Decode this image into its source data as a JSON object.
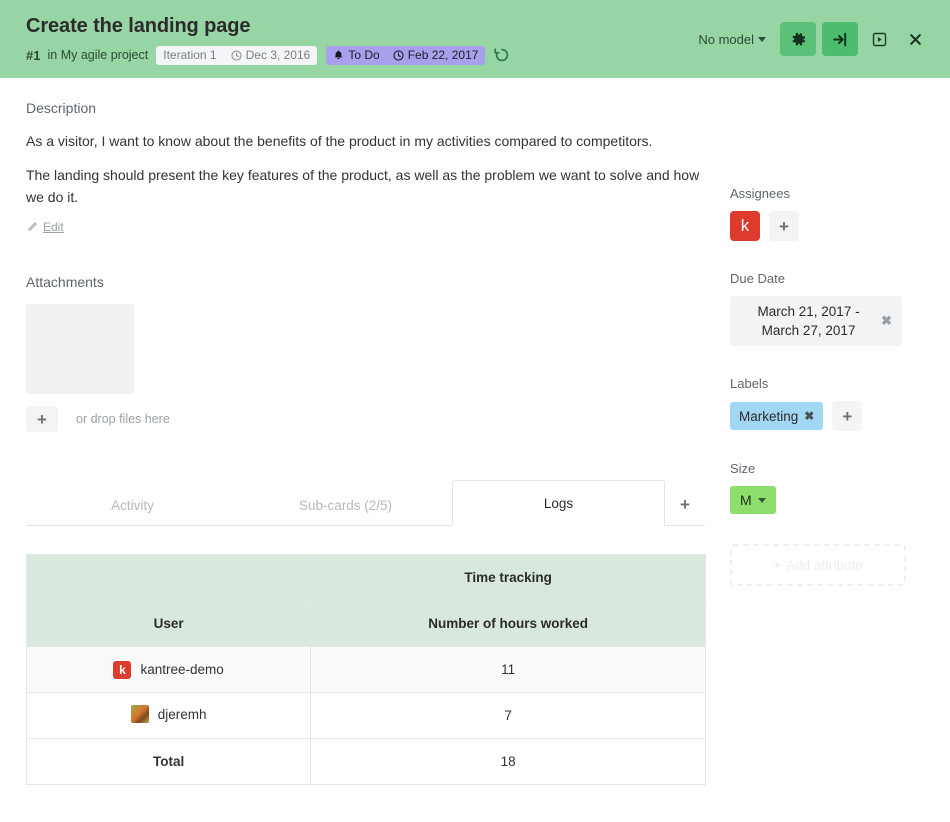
{
  "header": {
    "title": "Create the landing page",
    "card_number": "#1",
    "in_label": "in",
    "project_name": "My agile project",
    "iteration": {
      "name": "Iteration 1",
      "date": "Dec 3, 2016",
      "clock_icon": "clock-icon"
    },
    "status": {
      "label": "To Do",
      "date": "Feb 22, 2017",
      "bell_icon": "bell-icon",
      "clock_icon": "clock-icon",
      "color": "#a8a0ea"
    },
    "history_icon": "history-icon",
    "model_select": "No model",
    "buttons": {
      "gear": "gear-icon",
      "login": "sign-in-icon",
      "play": "play-box-icon",
      "close": "close-icon"
    },
    "background_color": "#97d5a4"
  },
  "description": {
    "heading": "Description",
    "paragraphs": [
      "As a visitor, I want to know about the benefits of the product in my activities compared to competitors.",
      "The landing should present the key features of the product, as well as the problem we want to solve and how we do it."
    ],
    "edit_label": "Edit",
    "edit_icon": "pencil-icon"
  },
  "attachments": {
    "heading": "Attachments",
    "add_label": "+",
    "drop_hint": "or drop files here"
  },
  "tabs": {
    "items": [
      {
        "label": "Activity",
        "active": false
      },
      {
        "label": "Sub-cards (2/5)",
        "active": false
      },
      {
        "label": "Logs",
        "active": true
      }
    ],
    "add_label": "+"
  },
  "log_table": {
    "group_header": "Time tracking",
    "columns": [
      "User",
      "Number of hours worked"
    ],
    "rows": [
      {
        "user": "kantree-demo",
        "avatar": "k",
        "avatar_type": "letter",
        "hours": "11"
      },
      {
        "user": "djeremh",
        "avatar": "",
        "avatar_type": "photo",
        "hours": "7"
      }
    ],
    "total_label": "Total",
    "total_value": "18"
  },
  "sidebar": {
    "assignees": {
      "label": "Assignees",
      "avatar_letter": "k",
      "avatar_color": "#dd3b2e",
      "add_label": "+"
    },
    "due_date": {
      "label": "Due Date",
      "value": "March 21, 2017 - March 27, 2017",
      "remove_label": "✖"
    },
    "labels": {
      "label": "Labels",
      "chips": [
        {
          "name": "Marketing",
          "remove": "✖",
          "color": "#a2d7f3"
        }
      ],
      "add_label": "+"
    },
    "size": {
      "label": "Size",
      "value": "M",
      "color": "#8ede6e"
    },
    "add_attribute": {
      "plus": "+",
      "label": "Add attribute"
    }
  }
}
